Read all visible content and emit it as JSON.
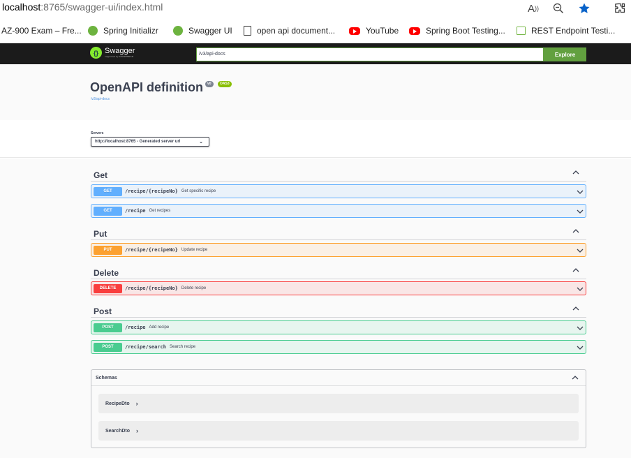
{
  "browser": {
    "url_host": "localhost",
    "url_rest": ":8765/swagger-ui/index.html",
    "bookmarks": [
      {
        "label": "AZ-900 Exam – Fre...",
        "icon": "none"
      },
      {
        "label": "Spring Initializr",
        "icon": "spring-icon"
      },
      {
        "label": "Swagger UI",
        "icon": "swagger-icon"
      },
      {
        "label": "open api document...",
        "icon": "document-icon"
      },
      {
        "label": "YouTube",
        "icon": "youtube-icon"
      },
      {
        "label": "Spring Boot Testing...",
        "icon": "youtube-icon"
      },
      {
        "label": "REST Endpoint Testi...",
        "icon": "rest-icon"
      }
    ]
  },
  "topbar": {
    "logo_title": "Swagger",
    "logo_sub": "supported by SMARTBEAR",
    "spec_url": "/v3/api-docs",
    "explore_label": "Explore"
  },
  "info": {
    "title": "OpenAPI definition",
    "version_badge": "v0",
    "oas_badge": "OAS3",
    "spec_link": "/v3/api-docs"
  },
  "servers": {
    "label": "Servers",
    "selected": "http://localhost:8765 - Generated server url"
  },
  "tags": [
    {
      "name": "Get",
      "operations": [
        {
          "method": "GET",
          "path": "/recipe/{recipeNo}",
          "summary": "Get specific recipe"
        },
        {
          "method": "GET",
          "path": "/recipe",
          "summary": "Get recipes"
        }
      ]
    },
    {
      "name": "Put",
      "operations": [
        {
          "method": "PUT",
          "path": "/recipe/{recipeNo}",
          "summary": "Update recipe"
        }
      ]
    },
    {
      "name": "Delete",
      "operations": [
        {
          "method": "DELETE",
          "path": "/recipe/{recipeNo}",
          "summary": "Delete recipe"
        }
      ]
    },
    {
      "name": "Post",
      "operations": [
        {
          "method": "POST",
          "path": "/recipe",
          "summary": "Add recipe"
        },
        {
          "method": "POST",
          "path": "/recipe/search",
          "summary": "Search recipe"
        }
      ]
    }
  ],
  "schemas": {
    "title": "Schemas",
    "models": [
      {
        "name": "RecipeDto",
        "arrow": "›"
      },
      {
        "name": "SearchDto",
        "arrow": "›"
      }
    ]
  },
  "colors": {
    "get": "#61affe",
    "put": "#fca130",
    "delete": "#f93e3e",
    "post": "#49cc90",
    "swagger_green": "#62a03f",
    "topbar": "#1b1b1b"
  }
}
